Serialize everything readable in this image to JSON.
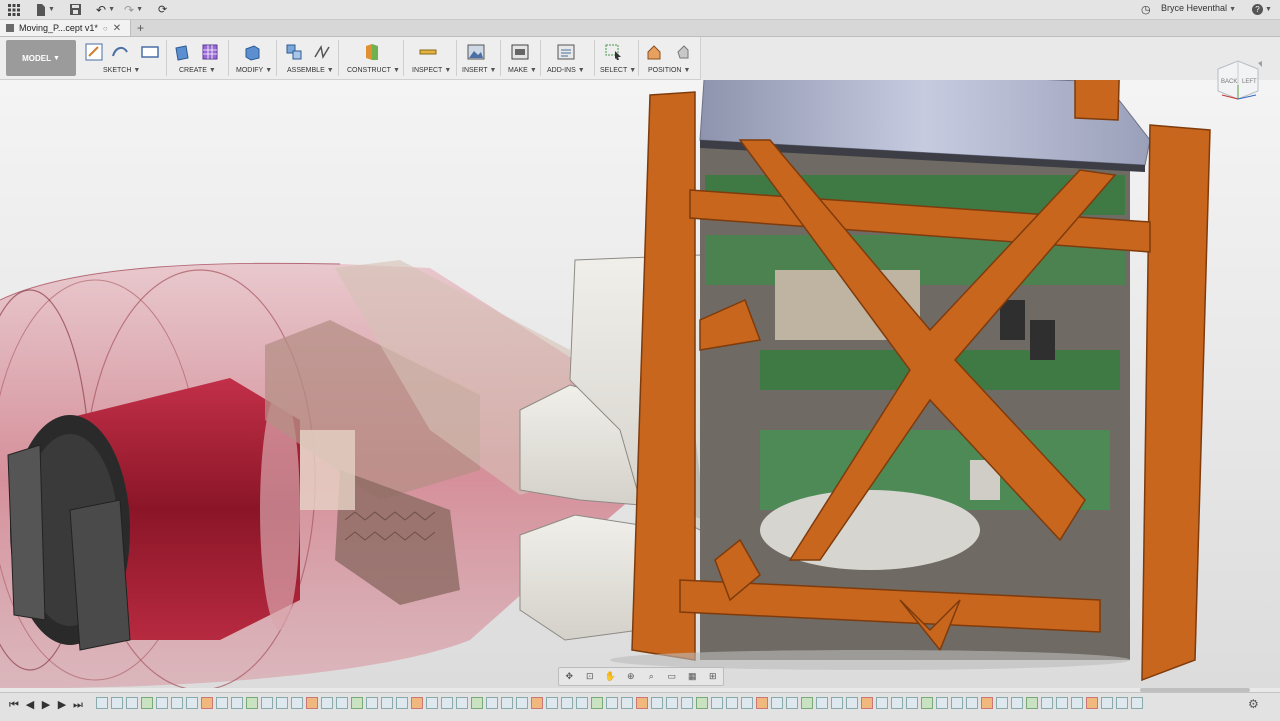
{
  "appbar": {
    "grid_icon": "grid-icon",
    "file_icon": "file-icon",
    "save_icon": "save-icon",
    "undo_icon": "undo-icon",
    "redo_icon": "redo-icon",
    "refresh_icon": "refresh-icon",
    "clock_icon": "clock-icon",
    "user_name": "Bryce Heventhal",
    "help_icon": "help-icon"
  },
  "tabs": {
    "document_title": "Moving_P...cept v1*",
    "close_icon": "close-icon",
    "add_tab_icon": "add-tab-icon"
  },
  "ribbon": {
    "workspace": "MODEL",
    "groups": [
      {
        "label": "SKETCH"
      },
      {
        "label": "CREATE"
      },
      {
        "label": "MODIFY"
      },
      {
        "label": "ASSEMBLE"
      },
      {
        "label": "CONSTRUCT"
      },
      {
        "label": "INSPECT"
      },
      {
        "label": "INSERT"
      },
      {
        "label": "MAKE"
      },
      {
        "label": "ADD-INS"
      },
      {
        "label": "SELECT"
      },
      {
        "label": "POSITION"
      }
    ]
  },
  "viewcube": {
    "face_back": "BACK",
    "face_left": "LEFT"
  },
  "colors": {
    "frame_orange": "#c8661e",
    "motor_red": "#b8243a",
    "gripper_gray": "#e3e1dc",
    "pcb_green": "#3f7a45",
    "solar_panel": "#a9afc7"
  }
}
